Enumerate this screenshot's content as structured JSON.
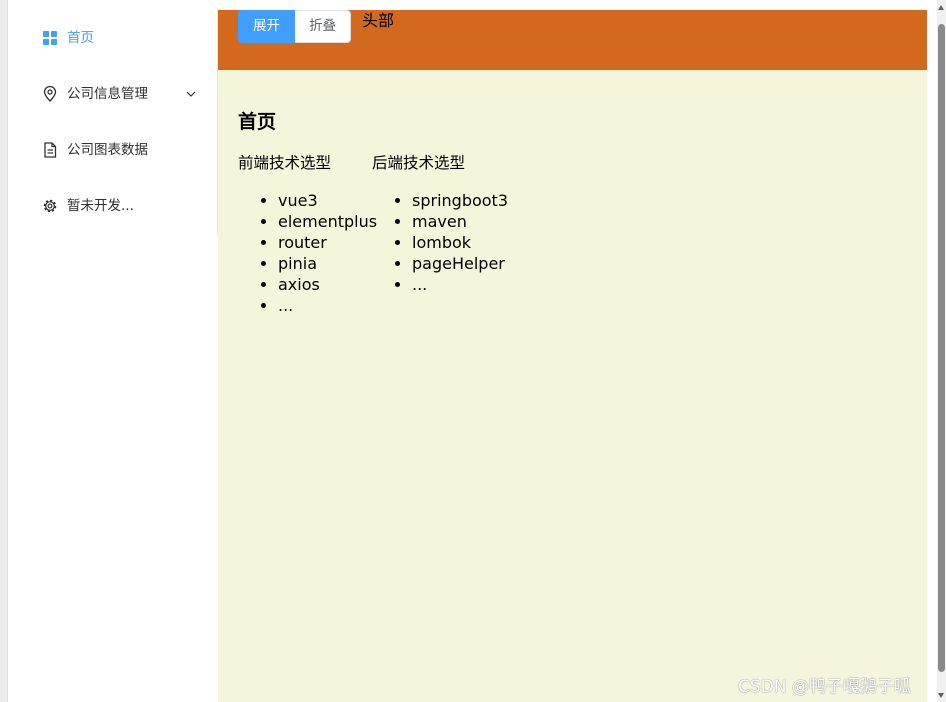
{
  "sidebar": {
    "items": [
      {
        "label": "首页",
        "icon": "grid-icon",
        "active": true
      },
      {
        "label": "公司信息管理",
        "icon": "location-icon",
        "has_submenu": true
      },
      {
        "label": "公司图表数据",
        "icon": "document-icon"
      },
      {
        "label": "暂未开发...",
        "icon": "gear-icon"
      }
    ]
  },
  "header": {
    "expand_label": "展开",
    "collapse_label": "折叠",
    "title": "头部"
  },
  "content": {
    "page_title": "首页",
    "frontend": {
      "title": "前端技术选型",
      "items": [
        "vue3",
        "elementplus",
        "router",
        "pinia",
        "axios",
        "..."
      ]
    },
    "backend": {
      "title": "后端技术选型",
      "items": [
        "springboot3",
        "maven",
        "lombok",
        "pageHelper",
        "..."
      ]
    }
  },
  "watermark": "CSDN @鸭子嘎鹅子呱",
  "colors": {
    "header": "#d2691e",
    "main_background": "#f5f5dc",
    "accent": "#409eff"
  }
}
